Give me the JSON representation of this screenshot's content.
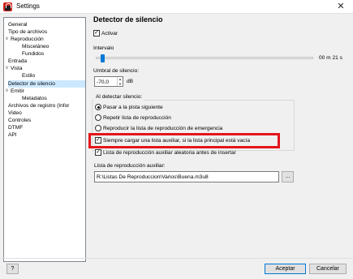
{
  "window": {
    "title": "Settings",
    "close_glyph": "✕",
    "app_icon": "app-logo-icon"
  },
  "tree": {
    "items": [
      {
        "label": "General",
        "expander": ""
      },
      {
        "label": "Tipo de archivos",
        "expander": ""
      },
      {
        "label": "Reproducción",
        "expander": "v"
      },
      {
        "label": "Misceláneo",
        "expander": ""
      },
      {
        "label": "Fundidos",
        "expander": ""
      },
      {
        "label": "Entrada",
        "expander": ""
      },
      {
        "label": "Vista",
        "expander": "v"
      },
      {
        "label": "Estilo",
        "expander": ""
      },
      {
        "label": "Detector de silencio",
        "expander": ""
      },
      {
        "label": "Emitir",
        "expander": "v"
      },
      {
        "label": "Metadatos",
        "expander": ""
      },
      {
        "label": "Archivos de registro (Infor",
        "expander": ""
      },
      {
        "label": "Video",
        "expander": ""
      },
      {
        "label": "Controles",
        "expander": ""
      },
      {
        "label": "DTMF",
        "expander": ""
      },
      {
        "label": "API",
        "expander": ""
      }
    ],
    "selected_label": "Detector de silencio"
  },
  "panel": {
    "title": "Detector de silencio",
    "activar": {
      "label": "Activar",
      "checked": true,
      "check_glyph": "✓"
    },
    "intervalo": {
      "label": "Intervalo",
      "value_text": "00 m 21 s"
    },
    "umbral": {
      "label": "Umbral de silencio:",
      "value": "-70,0",
      "unit": "dB",
      "arrow_up": "▲",
      "arrow_down": "▼"
    },
    "al_detectar": {
      "title": "Al detectar silencio:",
      "options": [
        {
          "label": "Pasar a la pista siguiente",
          "selected": true
        },
        {
          "label": "Repetir lista de reproducción",
          "selected": false
        },
        {
          "label": "Reproducir la lista de reproducción de emergencia",
          "selected": false
        }
      ]
    },
    "siempre_cargar": {
      "label": "Siempre cargar una lista auxiliar, si la lista principal está vacía",
      "checked": true,
      "check_glyph": "✓"
    },
    "aleatoria": {
      "label": "Lista de reproducción auxiliar aleatoria antes de insertar",
      "checked": true,
      "check_glyph": "✓"
    },
    "lista_auxiliar": {
      "label": "Lista de reproducción auxiliar:",
      "value": "R:\\Listas De Reproduccion\\Varios\\Buena.m3u8",
      "browse_label": "..."
    }
  },
  "footer": {
    "help_label": "?",
    "accept_label": "Aceptar",
    "cancel_label": "Cancelar"
  },
  "colors": {
    "accent": "#0078d7",
    "selection": "#cce8ff",
    "highlight_border": "#e4151c",
    "app_icon": "#d4261d"
  }
}
